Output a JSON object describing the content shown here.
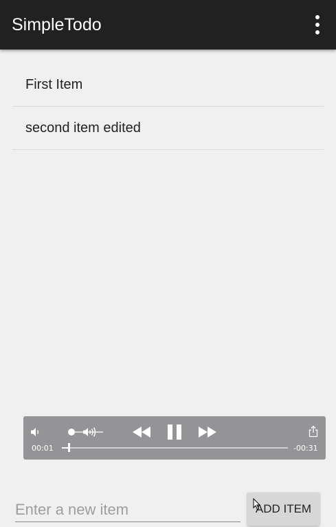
{
  "app": {
    "title": "SimpleTodo",
    "menu_icon": "more-vert-icon"
  },
  "todo_items": [
    {
      "text": "First Item"
    },
    {
      "text": "second item edited"
    }
  ],
  "media_player": {
    "current_time": "00:01",
    "remaining_time": "-00:31",
    "progress_fraction": 0.03,
    "volume_fraction": 0.0,
    "state": "playing",
    "icons": {
      "volume_low": "volume-low-icon",
      "volume_high": "volume-high-icon",
      "rewind": "rewind-icon",
      "pause": "pause-icon",
      "fast_forward": "fast-forward-icon",
      "share": "share-icon"
    }
  },
  "input": {
    "placeholder": "Enter a new item",
    "value": ""
  },
  "add_button": {
    "label": "ADD ITEM"
  },
  "colors": {
    "appbar": "#212121",
    "background": "#f0f0f0",
    "player": "#949396",
    "button": "#d7d7d7"
  }
}
